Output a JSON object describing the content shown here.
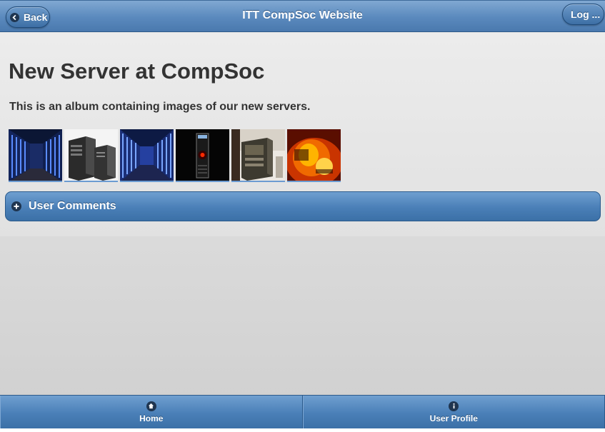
{
  "header": {
    "title": "ITT CompSoc Website",
    "back_label": "Back",
    "log_label": "Log ..."
  },
  "page": {
    "title": "New Server at CompSoc",
    "description": "This is an album containing images of our new servers."
  },
  "gallery": {
    "thumbnails": [
      "server-racks-blue-thumbnail",
      "tower-servers-thumbnail",
      "datacenter-aisle-thumbnail",
      "hal9000-panel-thumbnail",
      "broken-server-thumbnail",
      "computer-on-fire-thumbnail"
    ]
  },
  "comments": {
    "label": "User Comments",
    "icon": "plus-icon"
  },
  "footer": {
    "tabs": [
      {
        "label": "Home",
        "icon": "home-icon"
      },
      {
        "label": "User Profile",
        "icon": "info-icon"
      }
    ]
  },
  "colors": {
    "bar_blue": "#4a7fb7",
    "text_dark": "#333333"
  }
}
